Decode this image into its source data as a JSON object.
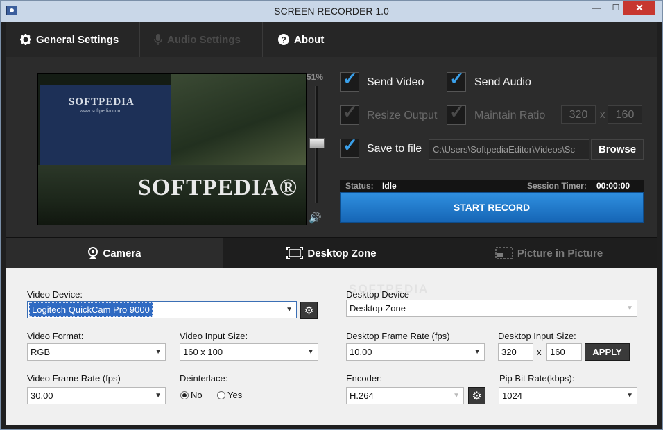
{
  "window": {
    "title": "SCREEN RECORDER 1.0",
    "minimize_glyph": "—",
    "maximize_glyph": "☐",
    "close_glyph": "✕"
  },
  "tabs": [
    {
      "label": "General Settings",
      "icon": "gear-icon",
      "state": "active"
    },
    {
      "label": "Audio Settings",
      "icon": "microphone-icon",
      "state": "disabled"
    },
    {
      "label": "About",
      "icon": "question-icon",
      "state": "normal"
    }
  ],
  "preview": {
    "brand_small": "SOFTPEDIA",
    "brand_url": "www.softpedia.com",
    "brand_big": "SOFTPEDIA®"
  },
  "volume": {
    "percent_label": "51%",
    "level": 0.51
  },
  "options": {
    "send_video": {
      "label": "Send Video",
      "checked": true,
      "enabled": true
    },
    "send_audio": {
      "label": "Send Audio",
      "checked": true,
      "enabled": true
    },
    "resize_output": {
      "label": "Resize Output",
      "checked": true,
      "enabled": false
    },
    "maintain_ratio": {
      "label": "Maintain Ratio",
      "checked": true,
      "enabled": false
    },
    "output_width": "320",
    "output_height": "160",
    "times": "x",
    "save_to_file": {
      "label": "Save to file",
      "checked": true,
      "enabled": true
    },
    "file_path": "C:\\Users\\SoftpediaEditor\\Videos\\Sc",
    "browse_label": "Browse"
  },
  "status": {
    "status_label": "Status:",
    "status_value": "Idle",
    "timer_label": "Session Timer:",
    "timer_value": "00:00:00"
  },
  "start_button": "START RECORD",
  "mode_tabs": [
    {
      "label": "Camera",
      "icon": "webcam-icon",
      "state": "normal"
    },
    {
      "label": "Desktop Zone",
      "icon": "desktop-zone-icon",
      "state": "active"
    },
    {
      "label": "Picture in Picture",
      "icon": "pip-icon",
      "state": "dim"
    }
  ],
  "camera": {
    "video_device_label": "Video Device:",
    "video_device_value": "Logitech QuickCam Pro 9000",
    "video_format_label": "Video Format:",
    "video_format_value": "RGB",
    "video_input_size_label": "Video Input Size:",
    "video_input_size_value": "160 x 100",
    "video_frame_rate_label": "Video Frame Rate (fps)",
    "video_frame_rate_value": "30.00",
    "deinterlace_label": "Deinterlace:",
    "deinterlace_options": [
      "No",
      "Yes"
    ],
    "deinterlace_selected": "No"
  },
  "desktop": {
    "desktop_device_label": "Desktop Device",
    "desktop_device_value": "Desktop Zone",
    "desktop_frame_rate_label": "Desktop Frame Rate (fps)",
    "desktop_frame_rate_value": "10.00",
    "desktop_input_size_label": "Desktop Input Size:",
    "desktop_input_width": "320",
    "desktop_input_height": "160",
    "times": "x",
    "apply_label": "APPLY",
    "encoder_label": "Encoder:",
    "encoder_value": "H.264",
    "pip_bitrate_label": "Pip Bit Rate(kbps):",
    "pip_bitrate_value": "1024"
  },
  "watermark": "SOFTPEDIA",
  "colors": {
    "accent": "#2f8fe0",
    "checked": "#3aa0ea",
    "close": "#c7372f"
  }
}
